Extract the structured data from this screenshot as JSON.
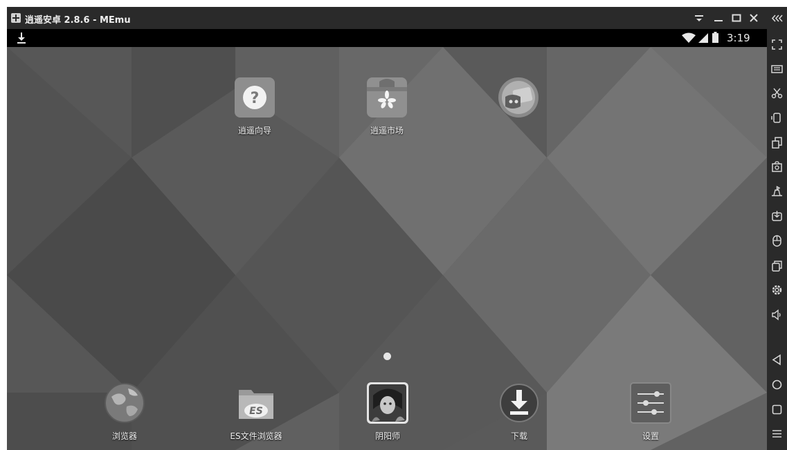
{
  "window": {
    "title": "逍遥安卓 2.8.6 - MEmu"
  },
  "statusbar": {
    "time": "3:19"
  },
  "home_apps": [
    {
      "label": "逍遥向导",
      "icon": "help-icon"
    },
    {
      "label": "逍遥市场",
      "icon": "market-icon"
    },
    {
      "label": "",
      "icon": "game-center-icon"
    }
  ],
  "dock_apps": [
    {
      "label": "浏览器",
      "icon": "browser-globe-icon"
    },
    {
      "label": "ES文件浏览器",
      "icon": "es-file-explorer-icon"
    },
    {
      "label": "阴阳师",
      "icon": "onmyoji-game-icon"
    },
    {
      "label": "下载",
      "icon": "download-icon"
    },
    {
      "label": "设置",
      "icon": "settings-icon"
    }
  ],
  "toolbar_icons": [
    "collapse-icon",
    "fullscreen-icon",
    "keyboard-icon",
    "scissors-icon",
    "rotate-icon",
    "multi-window-icon",
    "screenshot-icon",
    "location-icon",
    "install-apk-icon",
    "mouse-icon",
    "files-icon",
    "settings-gear-icon",
    "volume-icon",
    "back-icon",
    "home-icon",
    "recents-icon",
    "menu-icon"
  ],
  "colors": {
    "titlebar": "#2a2a2a",
    "statusbar": "#000000",
    "wallpaper_base": "#5c5c5c"
  }
}
